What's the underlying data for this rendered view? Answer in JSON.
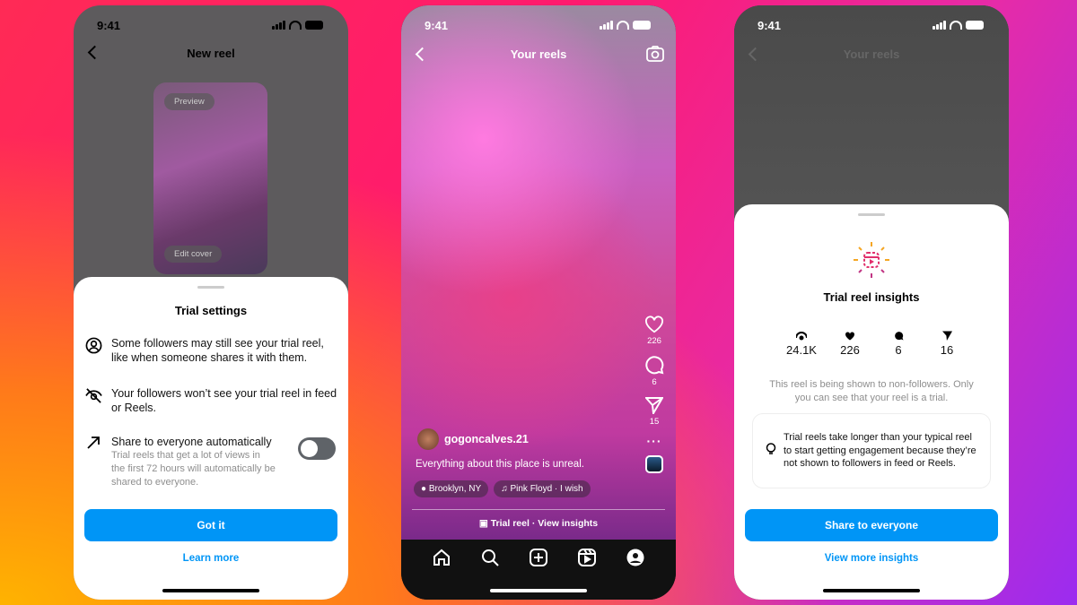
{
  "status_time": "9:41",
  "screen1": {
    "header_title": "New reel",
    "preview_label": "Preview",
    "edit_cover_label": "Edit cover",
    "sheet_title": "Trial settings",
    "items": [
      {
        "icon": "user-circle-icon",
        "text": "Some followers may still see your trial reel, like when someone shares it with them."
      },
      {
        "icon": "eye-off-icon",
        "text": "Your followers won’t see your trial reel in feed or Reels."
      }
    ],
    "auto_share": {
      "icon": "arrow-up-right-icon",
      "title": "Share to everyone automatically",
      "description": "Trial reels that get a lot of views in the first 72 hours will automatically be shared to everyone.",
      "enabled": false
    },
    "primary_button": "Got it",
    "secondary_link": "Learn more"
  },
  "screen2": {
    "header_title": "Your reels",
    "actions": [
      {
        "icon": "heart-icon",
        "count": "226"
      },
      {
        "icon": "comment-icon",
        "count": "6"
      },
      {
        "icon": "send-icon",
        "count": "15"
      }
    ],
    "username": "gogoncalves.21",
    "caption": "Everything about this place is unreal.",
    "location": "Brooklyn, NY",
    "audio": "Pink Floyd · I wish",
    "trial_bar": "Trial reel · View insights",
    "nav": [
      "home-icon",
      "search-icon",
      "create-icon",
      "reels-icon",
      "profile-icon"
    ]
  },
  "screen3": {
    "header_title": "Your reels",
    "sheet_title": "Trial reel insights",
    "stats": [
      {
        "icon": "views-icon",
        "value": "24.1K"
      },
      {
        "icon": "heart-icon",
        "value": "226"
      },
      {
        "icon": "comment-icon",
        "value": "6"
      },
      {
        "icon": "send-icon",
        "value": "16"
      }
    ],
    "note": "This reel is being shown to non-followers. Only you can see that your reel is a trial.",
    "tip": "Trial reels take longer than your typical reel to start getting engagement because they’re not shown to followers in feed or Reels.",
    "primary_button": "Share to everyone",
    "secondary_link": "View more insights"
  },
  "colors": {
    "accent": "#0095f6"
  }
}
